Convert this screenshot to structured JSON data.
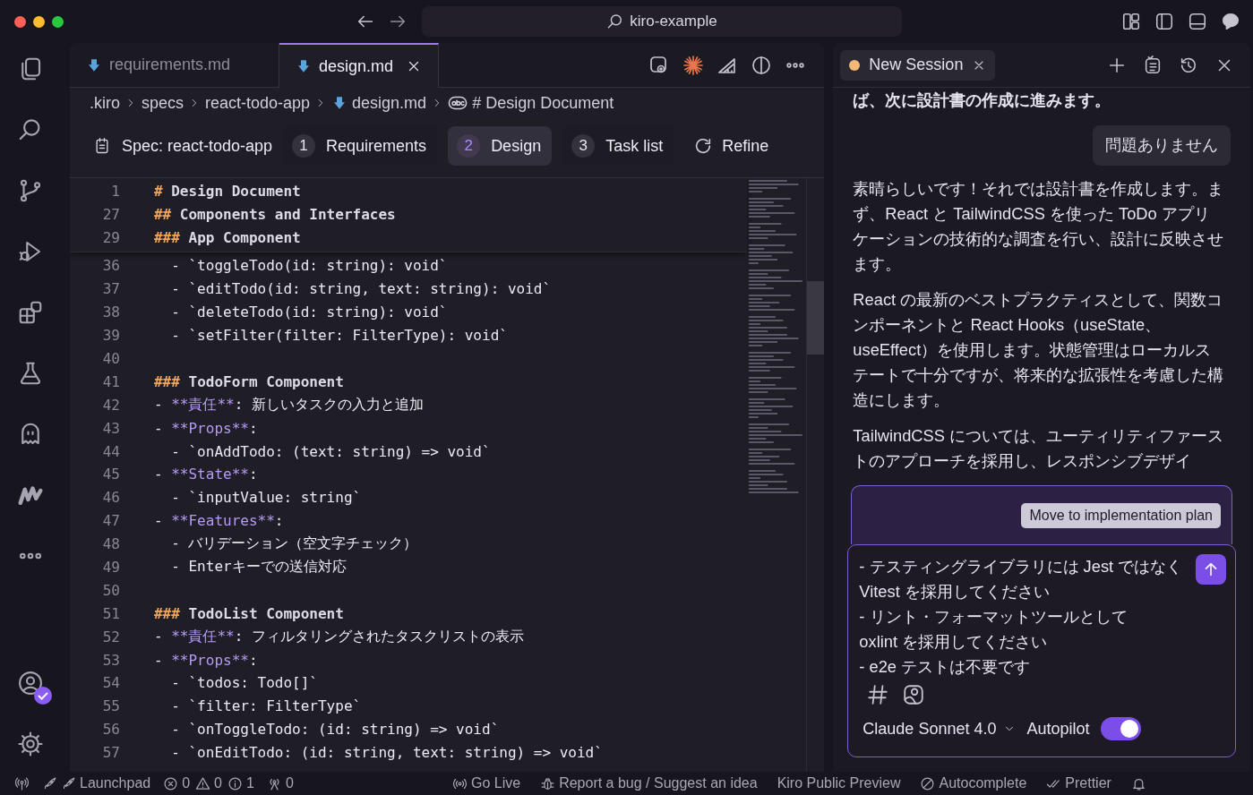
{
  "window": {
    "title": "kiro-example"
  },
  "editor": {
    "tabs": [
      {
        "label": "requirements.md",
        "selected": false
      },
      {
        "label": "design.md",
        "selected": true
      }
    ],
    "breadcrumbs": [
      {
        "kind": "folder",
        "text": ".kiro"
      },
      {
        "kind": "folder",
        "text": "specs"
      },
      {
        "kind": "folder",
        "text": "react-todo-app"
      },
      {
        "kind": "file",
        "text": "design.md"
      },
      {
        "kind": "symbol",
        "text": "# Design Document"
      }
    ],
    "spec": {
      "title": "Spec: react-todo-app",
      "refine": "Refine",
      "steps": [
        {
          "number": "1",
          "label": "Requirements",
          "selected": false
        },
        {
          "number": "2",
          "label": "Design",
          "selected": true
        },
        {
          "number": "3",
          "label": "Task list",
          "selected": false
        }
      ]
    },
    "sticky_lines": [
      {
        "number": "1",
        "segments": [
          {
            "kind": "mark",
            "text": "#"
          },
          {
            "kind": "heading",
            "text": " Design Document"
          }
        ]
      },
      {
        "number": "27",
        "segments": [
          {
            "kind": "mark",
            "text": "##"
          },
          {
            "kind": "heading",
            "text": " Components and Interfaces"
          }
        ]
      },
      {
        "number": "29",
        "segments": [
          {
            "kind": "mark",
            "text": "###"
          },
          {
            "kind": "heading",
            "text": " App Component"
          }
        ]
      }
    ],
    "lines": [
      {
        "number": "36",
        "segments": [
          {
            "kind": "text",
            "text": "  - `toggleTodo(id: string): void`"
          }
        ]
      },
      {
        "number": "37",
        "segments": [
          {
            "kind": "text",
            "text": "  - `editTodo(id: string, text: string): void`"
          }
        ]
      },
      {
        "number": "38",
        "segments": [
          {
            "kind": "text",
            "text": "  - `deleteTodo(id: string): void`"
          }
        ]
      },
      {
        "number": "39",
        "segments": [
          {
            "kind": "text",
            "text": "  - `setFilter(filter: FilterType): void`"
          }
        ]
      },
      {
        "number": "40"
      },
      {
        "number": "41",
        "segments": [
          {
            "kind": "mark",
            "text": "###"
          },
          {
            "kind": "heading",
            "text": " TodoForm Component"
          }
        ]
      },
      {
        "number": "42",
        "segments": [
          {
            "kind": "text",
            "text": "- "
          },
          {
            "kind": "strong",
            "text": "**責任**"
          },
          {
            "kind": "text",
            "text": ": 新しいタスクの入力と追加"
          }
        ]
      },
      {
        "number": "43",
        "segments": [
          {
            "kind": "text",
            "text": "- "
          },
          {
            "kind": "strong",
            "text": "**Props**"
          },
          {
            "kind": "text",
            "text": ":"
          }
        ]
      },
      {
        "number": "44",
        "segments": [
          {
            "kind": "text",
            "text": "  - `onAddTodo: (text: string) => void`"
          }
        ]
      },
      {
        "number": "45",
        "segments": [
          {
            "kind": "text",
            "text": "- "
          },
          {
            "kind": "strong",
            "text": "**State**"
          },
          {
            "kind": "text",
            "text": ":"
          }
        ]
      },
      {
        "number": "46",
        "segments": [
          {
            "kind": "text",
            "text": "  - `inputValue: string`"
          }
        ]
      },
      {
        "number": "47",
        "segments": [
          {
            "kind": "text",
            "text": "- "
          },
          {
            "kind": "strong",
            "text": "**Features**"
          },
          {
            "kind": "text",
            "text": ":"
          }
        ]
      },
      {
        "number": "48",
        "segments": [
          {
            "kind": "text",
            "text": "  - バリデーション（空文字チェック）"
          }
        ]
      },
      {
        "number": "49",
        "segments": [
          {
            "kind": "text",
            "text": "  - Enterキーでの送信対応"
          }
        ]
      },
      {
        "number": "50"
      },
      {
        "number": "51",
        "segments": [
          {
            "kind": "mark",
            "text": "###"
          },
          {
            "kind": "heading",
            "text": " TodoList Component"
          }
        ]
      },
      {
        "number": "52",
        "segments": [
          {
            "kind": "text",
            "text": "- "
          },
          {
            "kind": "strong",
            "text": "**責任**"
          },
          {
            "kind": "text",
            "text": ": フィルタリングされたタスクリストの表示"
          }
        ]
      },
      {
        "number": "53",
        "segments": [
          {
            "kind": "text",
            "text": "- "
          },
          {
            "kind": "strong",
            "text": "**Props**"
          },
          {
            "kind": "text",
            "text": ":"
          }
        ]
      },
      {
        "number": "54",
        "segments": [
          {
            "kind": "text",
            "text": "  - `todos: Todo[]`"
          }
        ]
      },
      {
        "number": "55",
        "segments": [
          {
            "kind": "text",
            "text": "  - `filter: FilterType`"
          }
        ]
      },
      {
        "number": "56",
        "segments": [
          {
            "kind": "text",
            "text": "  - `onToggleTodo: (id: string) => void`"
          }
        ]
      },
      {
        "number": "57",
        "segments": [
          {
            "kind": "text",
            "text": "  - `onEditTodo: (id: string, text: string) => void`"
          }
        ]
      }
    ]
  },
  "chat": {
    "session": {
      "title": "New Session"
    },
    "messages": [
      {
        "kind": "assistant",
        "bold": true,
        "text": "ば、次に設計書の作成に進みます。"
      },
      {
        "kind": "user",
        "bold": false,
        "text": "問題ありません"
      },
      {
        "kind": "assistant",
        "bold": false,
        "text": "素晴らしいです！それでは設計書を作成します。まず、React と TailwindCSS を使った ToDo アプリケーションの技術的な調査を行い、設計に反映させます。"
      },
      {
        "kind": "assistant",
        "bold": false,
        "text": "React の最新のベストプラクティスとして、関数コンポーネントと React Hooks（useState、useEffect）を使用します。状態管理はローカルステートで十分ですが、将来的な拡張性を考慮した構造にします。"
      },
      {
        "kind": "assistant",
        "bold": false,
        "text": "TailwindCSS については、ユーティリティファーストのアプローチを採用し、レスポンシブデザイ"
      }
    ],
    "action_button": "Move to implementation plan",
    "input": {
      "value": "- テスティングライブラリには Jest ではなく Vitest を採用してください\n- リント・フォーマットツールとして\noxlint を採用してください\n- e2e テストは不要です"
    },
    "model": "Claude Sonnet 4.0",
    "autopilot": {
      "label": "Autopilot",
      "on": true
    }
  },
  "status_bar": {
    "items": [
      {
        "kind": "broadcast"
      },
      {
        "kind": "launchpad",
        "text": "Launchpad"
      },
      {
        "kind": "errors",
        "text": "0"
      },
      {
        "kind": "warnings",
        "text": "0"
      },
      {
        "kind": "info",
        "text": "1"
      },
      {
        "kind": "ports",
        "text": "0"
      },
      {
        "kind": "live",
        "text": "Go Live"
      },
      {
        "kind": "bug",
        "text": "Report a bug / Suggest an idea"
      },
      {
        "kind": "plain",
        "text": "Kiro Public Preview"
      },
      {
        "kind": "autocomplete",
        "text": "Autocomplete"
      },
      {
        "kind": "prettier",
        "text": "Prettier"
      },
      {
        "kind": "bell"
      }
    ]
  }
}
